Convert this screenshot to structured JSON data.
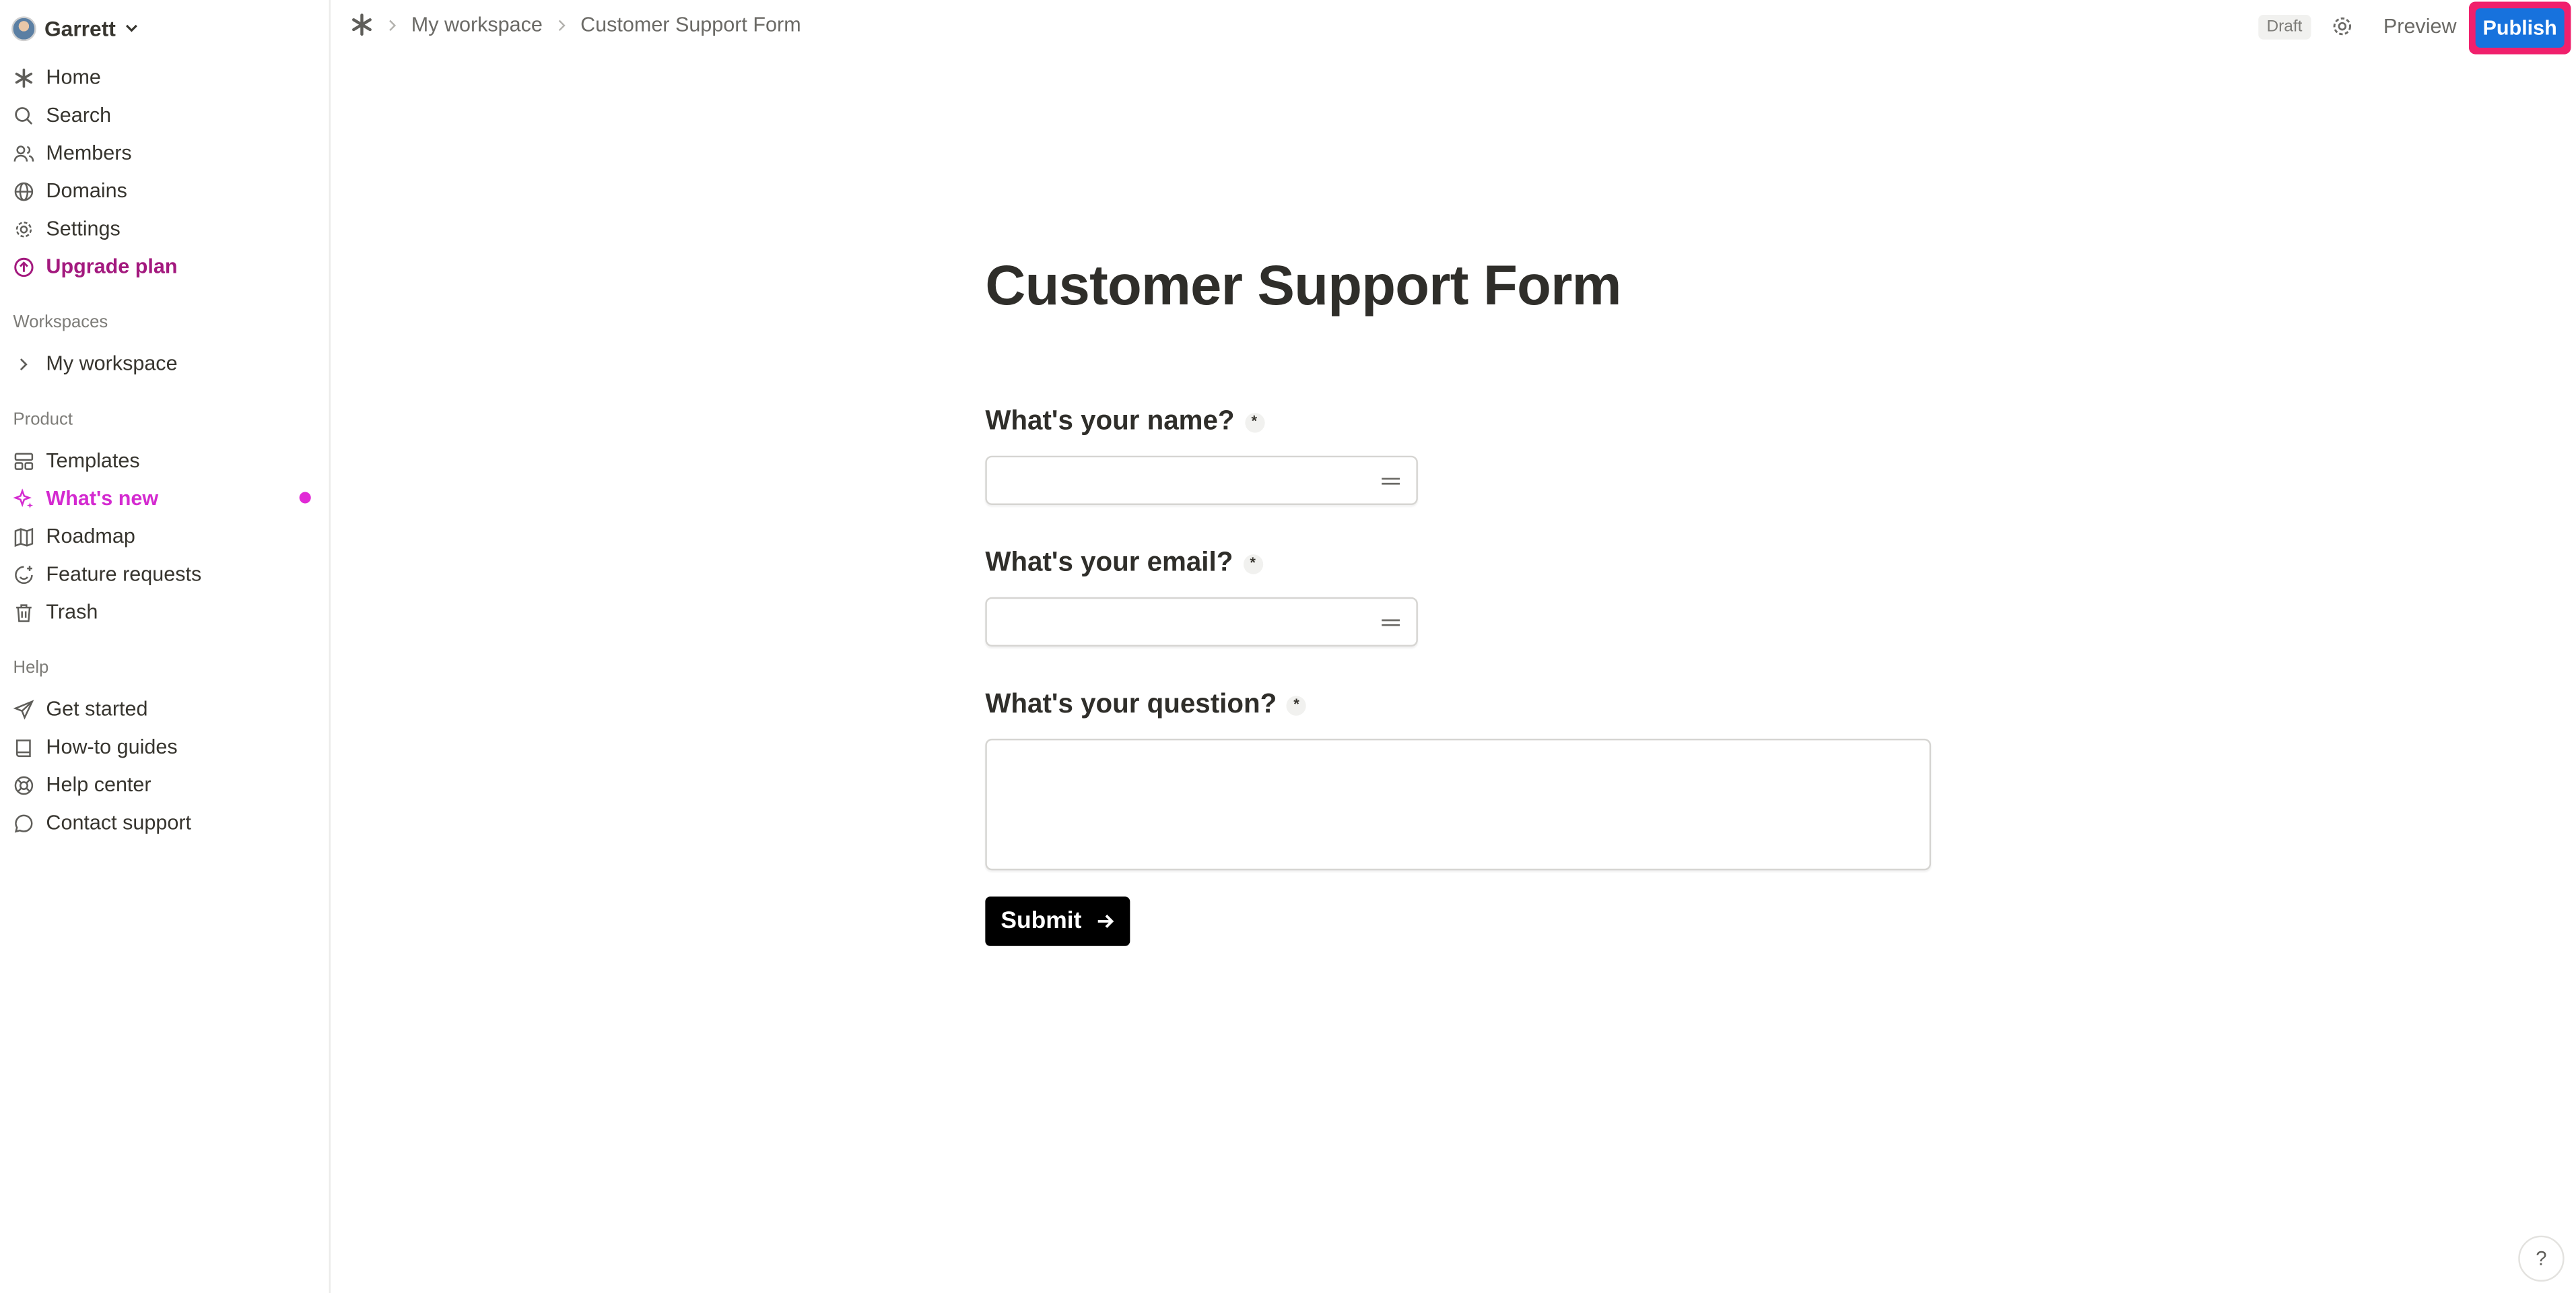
{
  "account": {
    "name": "Garrett"
  },
  "sidebar": {
    "nav": [
      {
        "label": "Home",
        "icon": "asterisk-icon"
      },
      {
        "label": "Search",
        "icon": "search-icon"
      },
      {
        "label": "Members",
        "icon": "users-icon"
      },
      {
        "label": "Domains",
        "icon": "globe-icon"
      },
      {
        "label": "Settings",
        "icon": "gear-icon"
      },
      {
        "label": "Upgrade plan",
        "icon": "arrow-up-circle-icon"
      }
    ],
    "workspaces_label": "Workspaces",
    "workspaces": [
      {
        "label": "My workspace",
        "icon": "chevron-right-icon"
      }
    ],
    "product_label": "Product",
    "product": [
      {
        "label": "Templates",
        "icon": "templates-icon"
      },
      {
        "label": "What's new",
        "icon": "sparkle-icon",
        "has_dot": true
      },
      {
        "label": "Roadmap",
        "icon": "map-icon"
      },
      {
        "label": "Feature requests",
        "icon": "smile-plus-icon"
      },
      {
        "label": "Trash",
        "icon": "trash-icon"
      }
    ],
    "help_label": "Help",
    "help": [
      {
        "label": "Get started",
        "icon": "send-icon"
      },
      {
        "label": "How-to guides",
        "icon": "book-icon"
      },
      {
        "label": "Help center",
        "icon": "lifebuoy-icon"
      },
      {
        "label": "Contact support",
        "icon": "chat-icon"
      }
    ]
  },
  "topbar": {
    "breadcrumbs": [
      "My workspace",
      "Customer Support Form"
    ],
    "status": "Draft",
    "preview_label": "Preview",
    "publish_label": "Publish"
  },
  "form": {
    "title": "Customer Support Form",
    "questions": [
      {
        "label": "What's your name?",
        "required_mark": "*",
        "type": "short",
        "value": ""
      },
      {
        "label": "What's your email?",
        "required_mark": "*",
        "type": "short",
        "value": ""
      },
      {
        "label": "What's your question?",
        "required_mark": "*",
        "type": "long",
        "value": ""
      }
    ],
    "submit_label": "Submit"
  },
  "help_button": {
    "label": "?"
  },
  "colors": {
    "accent_upgrade": "#a3197e",
    "accent_whats_new": "#d42ad0",
    "publish_button": "#1772dd",
    "publish_highlight": "#f0206c",
    "submit_button": "#000000"
  }
}
